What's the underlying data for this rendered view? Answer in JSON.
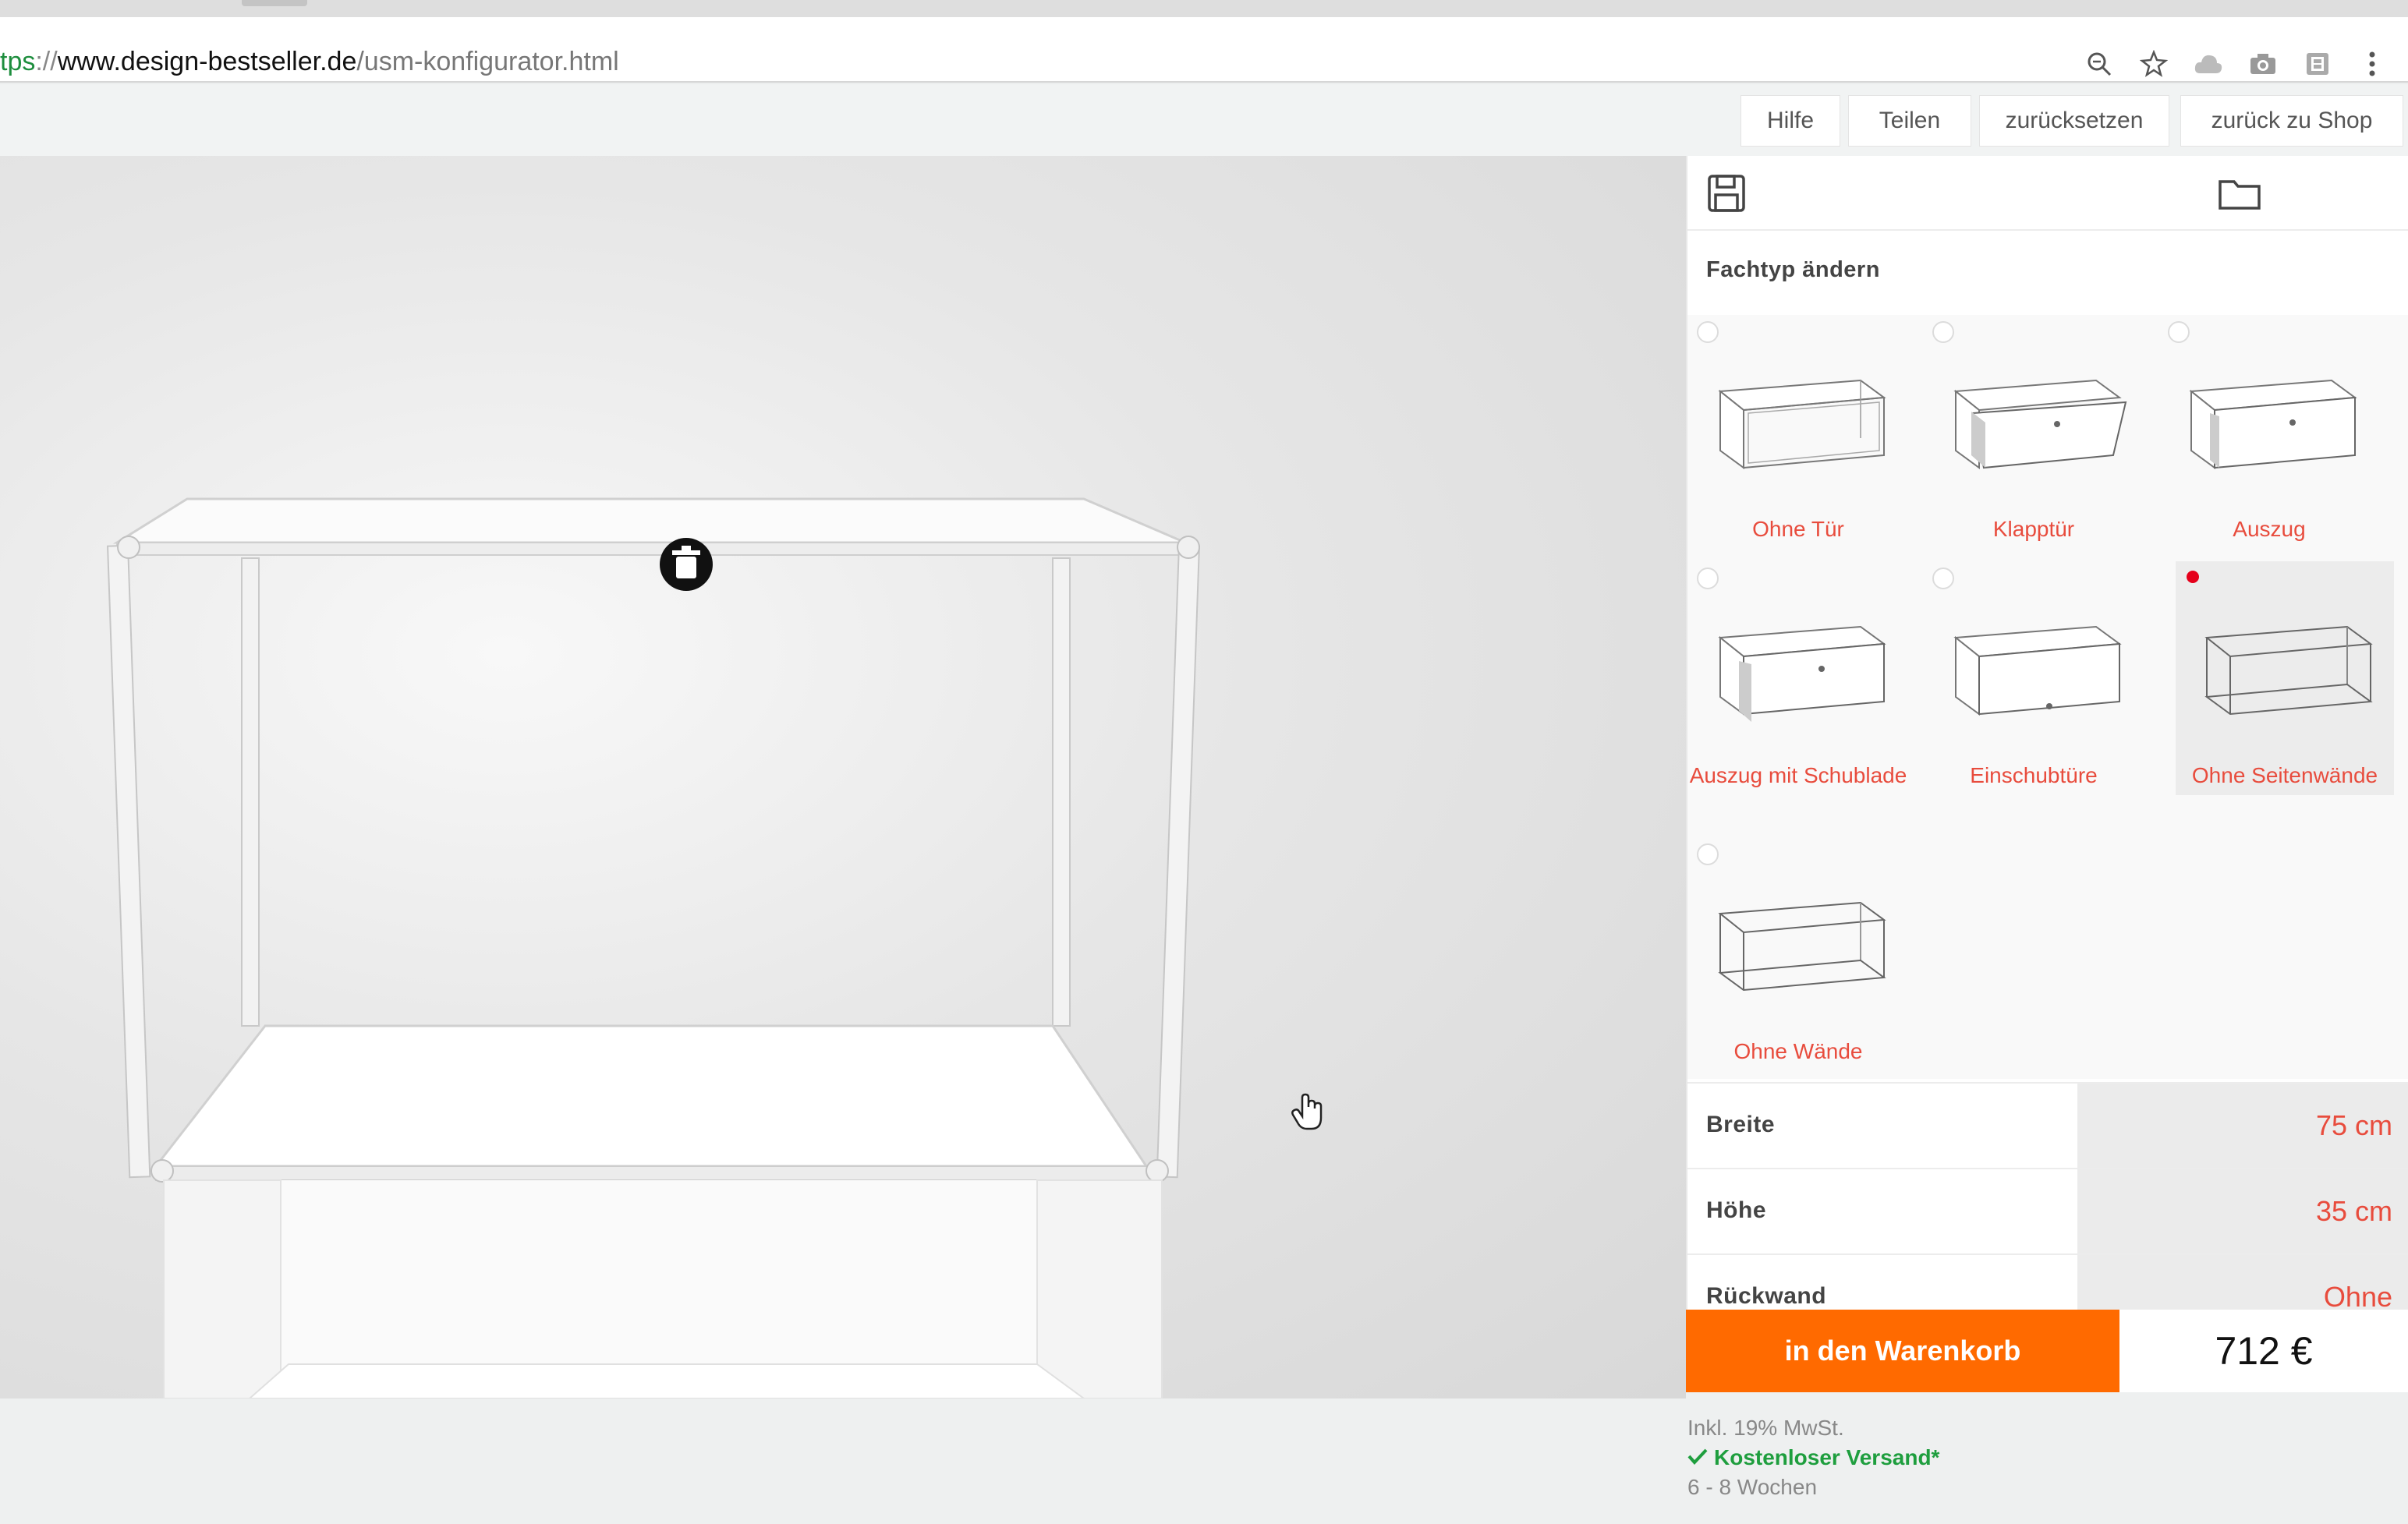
{
  "browser": {
    "url_scheme": "tps",
    "url_sep": "://",
    "url_host": "www.design-bestseller.de",
    "url_path": "/usm-konfigurator.html",
    "icons": [
      "zoom-icon",
      "star-icon",
      "cloud-icon",
      "camera-icon",
      "extension-icon",
      "menu-dots-icon"
    ]
  },
  "topnav": {
    "help": "Hilfe",
    "share": "Teilen",
    "reset": "zurücksetzen",
    "back_to_shop": "zurück zu Shop"
  },
  "panel": {
    "section_title": "Fachtyp ändern",
    "types": [
      {
        "label": "Ohne Tür",
        "selected": false
      },
      {
        "label": "Klapptür",
        "selected": false
      },
      {
        "label": "Auszug",
        "selected": false
      },
      {
        "label": "Auszug mit Schublade",
        "selected": false
      },
      {
        "label": "Einschubtüre",
        "selected": false
      },
      {
        "label": "Ohne Seitenwände",
        "selected": true
      },
      {
        "label": "Ohne Wände",
        "selected": false
      }
    ],
    "properties": [
      {
        "name": "Breite",
        "value": "75 cm"
      },
      {
        "name": "Höhe",
        "value": "35 cm"
      },
      {
        "name": "Rückwand",
        "value": "Ohne"
      }
    ]
  },
  "cart": {
    "button_label": "in den Warenkorb",
    "price": "712 €",
    "vat_note": "Inkl. 19% MwSt.",
    "shipping": "Kostenloser Versand*",
    "delivery": "6 - 8 Wochen"
  },
  "colors": {
    "accent_orange": "#ff6a00",
    "label_red": "#e84c3d",
    "shipping_green": "#1e9e3e",
    "selected_dot": "#e5001b"
  }
}
